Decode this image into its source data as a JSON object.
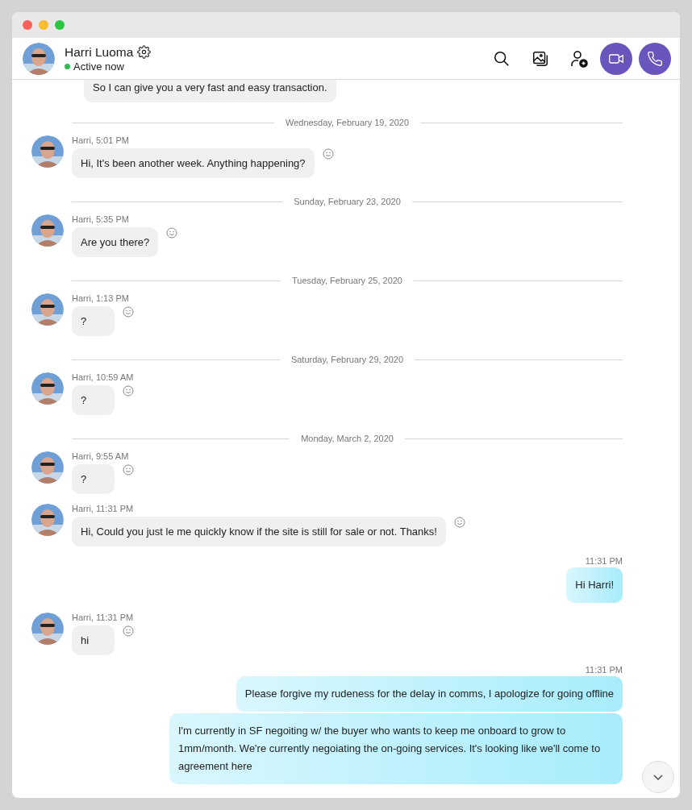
{
  "contact": {
    "name": "Harri Luoma",
    "status": "Active now",
    "online": true
  },
  "messages": [
    {
      "kind": "cut",
      "text": "So I can give you a very fast and easy transaction."
    },
    {
      "kind": "date",
      "text": "Wednesday, February 19, 2020"
    },
    {
      "kind": "incoming",
      "meta": "Harri, 5:01 PM",
      "text": "Hi, It's been another week. Anything happening?"
    },
    {
      "kind": "date",
      "text": "Sunday, February 23, 2020"
    },
    {
      "kind": "incoming",
      "meta": "Harri, 5:35 PM",
      "text": "Are you there?"
    },
    {
      "kind": "date",
      "text": "Tuesday, February 25, 2020"
    },
    {
      "kind": "incoming",
      "meta": "Harri, 1:13 PM",
      "text": "?"
    },
    {
      "kind": "date",
      "text": "Saturday, February 29, 2020"
    },
    {
      "kind": "incoming",
      "meta": "Harri, 10:59 AM",
      "text": "?"
    },
    {
      "kind": "date",
      "text": "Monday, March 2, 2020"
    },
    {
      "kind": "incoming",
      "meta": "Harri, 9:55 AM",
      "text": "?"
    },
    {
      "kind": "incoming",
      "meta": "Harri, 11:31 PM",
      "text": "Hi, Could you just le me quickly know if the site is still for sale or not. Thanks!"
    },
    {
      "kind": "outgoing",
      "meta": "11:31 PM",
      "texts": [
        "Hi Harri!"
      ]
    },
    {
      "kind": "incoming",
      "meta": "Harri, 11:31 PM",
      "text": "hi"
    },
    {
      "kind": "outgoing",
      "meta": "11:31 PM",
      "texts": [
        "Please forgive my rudeness for the delay in comms, I apologize for going offline",
        "I'm currently in SF negoiting w/ the buyer who wants to keep me onboard to grow to 1mm/month. We're currently negoiating the on-going services. It's looking like we'll come to agreement here"
      ]
    }
  ]
}
